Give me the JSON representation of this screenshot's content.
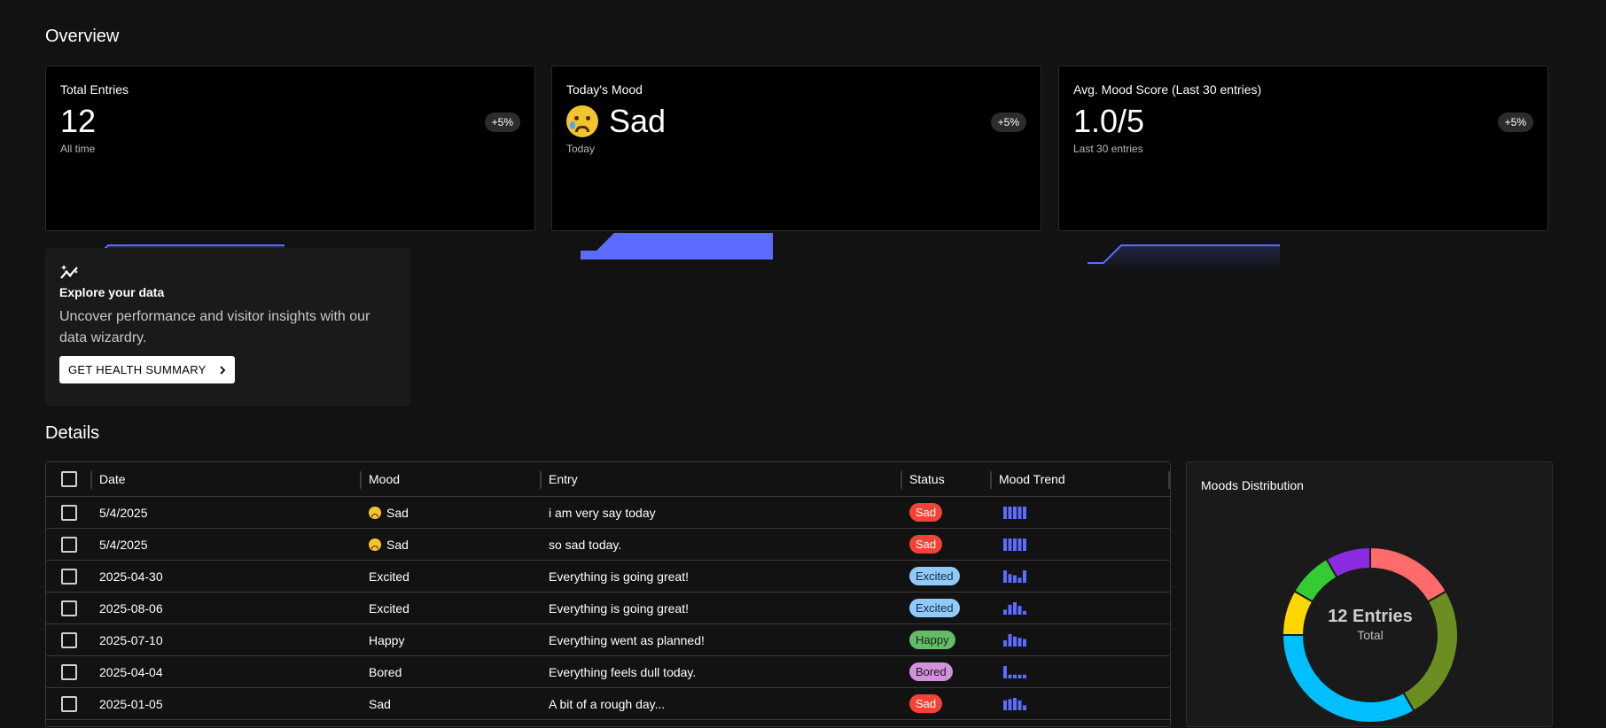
{
  "overview": {
    "heading": "Overview",
    "cards": [
      {
        "title": "Total Entries",
        "value": "12",
        "sub": "All time",
        "badge": "+5%"
      },
      {
        "title": "Today's Mood",
        "value": "Sad",
        "sub": "Today",
        "badge": "+5%",
        "emoji_icon": "crying-face-icon"
      },
      {
        "title": "Avg. Mood Score (Last 30 entries)",
        "value": "1.0/5",
        "sub": "Last 30 entries",
        "badge": "+5%"
      }
    ]
  },
  "explore": {
    "icon": "insights-icon",
    "title": "Explore your data",
    "description": "Uncover performance and visitor insights with our data wizardry.",
    "button_label": "GET HEALTH SUMMARY",
    "button_icon": "chevron-right-icon"
  },
  "details": {
    "heading": "Details",
    "columns": [
      "Date",
      "Mood",
      "Entry",
      "Status",
      "Mood Trend"
    ],
    "rows": [
      {
        "date": "5/4/2025",
        "mood": "Sad",
        "mood_emoji": true,
        "entry": "i am very say today",
        "status": "Sad",
        "trend": [
          1,
          1,
          1,
          1,
          1
        ]
      },
      {
        "date": "5/4/2025",
        "mood": "Sad",
        "mood_emoji": true,
        "entry": "so sad today.",
        "status": "Sad",
        "trend": [
          1,
          1,
          1,
          1,
          1
        ]
      },
      {
        "date": "2025-04-30",
        "mood": "Excited",
        "mood_emoji": false,
        "entry": "Everything is going great!",
        "status": "Excited",
        "trend": [
          1,
          0.7,
          0.6,
          0.4,
          1
        ]
      },
      {
        "date": "2025-08-06",
        "mood": "Excited",
        "mood_emoji": false,
        "entry": "Everything is going great!",
        "status": "Excited",
        "trend": [
          0.4,
          0.8,
          1,
          0.7,
          0.3
        ]
      },
      {
        "date": "2025-07-10",
        "mood": "Happy",
        "mood_emoji": false,
        "entry": "Everything went as planned!",
        "status": "Happy",
        "trend": [
          0.5,
          1,
          0.8,
          0.7,
          0.6
        ]
      },
      {
        "date": "2025-04-04",
        "mood": "Bored",
        "mood_emoji": false,
        "entry": "Everything feels dull today.",
        "status": "Bored",
        "trend": [
          1,
          0.3,
          0.3,
          0.3,
          0.3
        ]
      },
      {
        "date": "2025-01-05",
        "mood": "Sad",
        "mood_emoji": false,
        "entry": "A bit of a rough day...",
        "status": "Sad",
        "trend": [
          0.8,
          0.9,
          1,
          0.8,
          0.4
        ]
      }
    ]
  },
  "status_colors": {
    "Sad": {
      "bg": "#f44336",
      "fg": "#ffffff"
    },
    "Excited": {
      "bg": "#90caf9",
      "fg": "#1a2a40"
    },
    "Happy": {
      "bg": "#66bb6a",
      "fg": "#0f2a10"
    },
    "Bored": {
      "bg": "#ce93d8",
      "fg": "#2a0f30"
    }
  },
  "moods_distribution": {
    "title": "Moods Distribution",
    "center_value": "12 Entries",
    "center_label": "Total",
    "segments": [
      {
        "color": "#ff6b6b",
        "value": 2
      },
      {
        "color": "#6b8e23",
        "value": 3
      },
      {
        "color": "#00bfff",
        "value": 4
      },
      {
        "color": "#ffd700",
        "value": 1
      },
      {
        "color": "#33cc33",
        "value": 1
      },
      {
        "color": "#8a2be2",
        "value": 1
      }
    ]
  },
  "accent_color": "#5b6cff"
}
